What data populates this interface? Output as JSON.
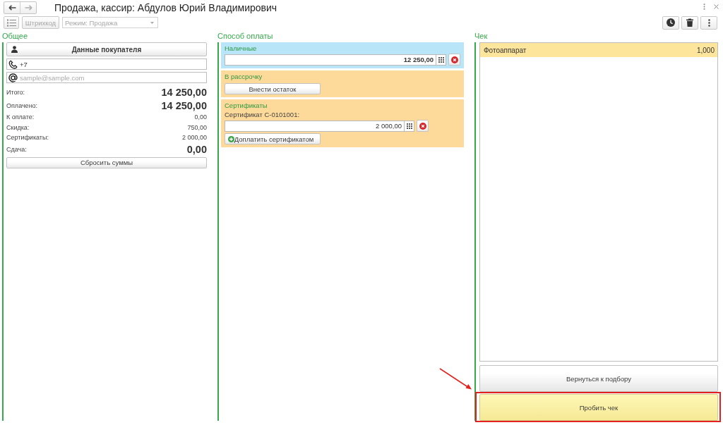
{
  "window": {
    "title": "Продажа, кассир: Абдулов Юрий Владимирович",
    "nav_buttons": [
      {
        "kind": "back",
        "disabled": false
      },
      {
        "kind": "forward",
        "disabled": true
      }
    ]
  },
  "toolbar": {
    "barcode_button": {
      "label": "Штрихкод",
      "disabled": true
    },
    "mode_field": {
      "value": "Режим: Продажа",
      "disabled": true
    }
  },
  "general": {
    "title": "Общее",
    "customer_button": "Данные покупателя",
    "phone_field": {
      "value": "+7"
    },
    "email_field": {
      "placeholder": "sample@sample.com"
    },
    "totals": [
      {
        "label": "Итого:",
        "value": "14 250,00",
        "kind": "major"
      },
      {
        "label": "Оплачено:",
        "value": "14 250,00",
        "kind": "major"
      },
      {
        "label": "К оплате:",
        "value": "0,00",
        "kind": "minor"
      },
      {
        "label": "Скидка:",
        "value": "750,00",
        "kind": "minor"
      },
      {
        "label": "Сертификаты:",
        "value": "2 000,00",
        "kind": "minor"
      },
      {
        "label": "Сдача:",
        "value": "0,00",
        "kind": "major"
      }
    ],
    "reset_button": "Сбросить суммы"
  },
  "payment": {
    "title": "Способ оплаты",
    "methods": [
      {
        "title": "Наличные",
        "selected": true,
        "entries": [
          {
            "amount": "12 250,00"
          }
        ]
      },
      {
        "title": "В рассрочку",
        "selected": false,
        "button": {
          "label": "Внести остаток",
          "kind": "plain"
        }
      },
      {
        "title": "Сертификаты",
        "selected": false,
        "entries": [
          {
            "label": "Сертификат С-0101001:",
            "amount": "2 000,00"
          }
        ],
        "button": {
          "label": "Доплатить сертификатом",
          "kind": "add"
        }
      }
    ]
  },
  "receipt": {
    "title": "Чек",
    "items": [
      {
        "name": "Фотоаппарат",
        "quantity": "1,000",
        "selected": true
      }
    ],
    "back_button": "Вернуться к подбору",
    "pay_button": "Пробить чек"
  }
}
